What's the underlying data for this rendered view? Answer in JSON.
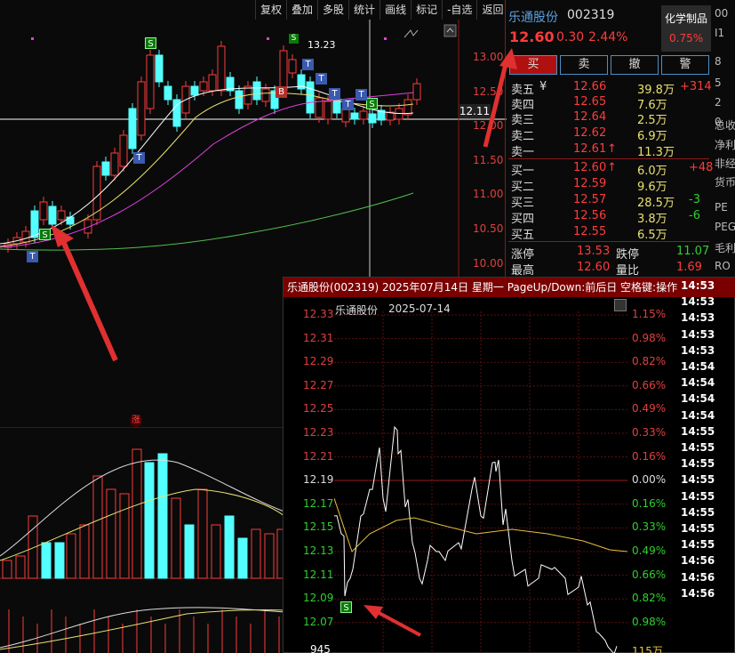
{
  "toolbar": {
    "items": [
      "复权",
      "叠加",
      "多股",
      "统计",
      "画线",
      "标记",
      "-自选",
      "返回"
    ]
  },
  "stock": {
    "name": "乐通股份",
    "code": "002319",
    "price": "12.60",
    "change": "0.30",
    "pct": "2.44%",
    "sector": "化学制品",
    "sector_pct": "0.75%"
  },
  "trade_buttons": {
    "buy": "买",
    "sell": "卖",
    "cancel": "撤",
    "alert": "警"
  },
  "kline": {
    "price_labels": [
      "13.00",
      "12.50",
      "12.00",
      "11.50",
      "11.00",
      "10.50",
      "10.00"
    ],
    "current_price_tag": "12.11",
    "high_label": "13.23",
    "markers": {
      "s": "S",
      "t": "T",
      "b": "B"
    },
    "limit_up_icon": "涨"
  },
  "order_book": {
    "asks": [
      {
        "label": "卖五",
        "price": "12.66",
        "vol": "39.8万",
        "extra": "+314",
        "yen": "¥"
      },
      {
        "label": "卖四",
        "price": "12.65",
        "vol": "7.6万",
        "extra": ""
      },
      {
        "label": "卖三",
        "price": "12.64",
        "vol": "2.5万",
        "extra": ""
      },
      {
        "label": "卖二",
        "price": "12.62",
        "vol": "6.9万",
        "extra": ""
      },
      {
        "label": "卖一",
        "price": "12.61",
        "vol": "11.3万",
        "extra": "",
        "arrow": "↑"
      }
    ],
    "bids": [
      {
        "label": "买一",
        "price": "12.60",
        "vol": "6.0万",
        "extra": "+48",
        "arrow": "↑"
      },
      {
        "label": "买二",
        "price": "12.59",
        "vol": "9.6万",
        "extra": ""
      },
      {
        "label": "买三",
        "price": "12.57",
        "vol": "28.5万",
        "extra": "-3"
      },
      {
        "label": "买四",
        "price": "12.56",
        "vol": "3.8万",
        "extra": "-6"
      },
      {
        "label": "买五",
        "price": "12.55",
        "vol": "6.5万",
        "extra": ""
      }
    ],
    "stats": [
      {
        "l1": "涨停",
        "v1": "13.53",
        "l2": "跌停",
        "v2": "11.07"
      },
      {
        "l1": "最高",
        "v1": "12.60",
        "l2": "量比",
        "v2": "1.69"
      }
    ]
  },
  "sidebar": {
    "items": [
      "00",
      "I1",
      "8",
      "5",
      "2",
      "0",
      "总收",
      "净利",
      "非经",
      "货币",
      "PE",
      "PEG",
      "毛利",
      "RO"
    ]
  },
  "popup": {
    "title": "乐通股份(002319) 2025年07月14日 星期一 PageUp/Down:前后日 空格键:操作",
    "subtitle_name": "乐通股份",
    "subtitle_date": "2025-07-14",
    "left_labels": [
      "12.33",
      "12.31",
      "12.29",
      "12.27",
      "12.25",
      "12.23",
      "12.21",
      "12.19",
      "12.17",
      "12.15",
      "12.13",
      "12.11",
      "12.09",
      "12.07"
    ],
    "right_labels": [
      "1.15%",
      "0.98%",
      "0.82%",
      "0.66%",
      "0.49%",
      "0.33%",
      "0.16%",
      "0.00%",
      "0.16%",
      "0.33%",
      "0.49%",
      "0.66%",
      "0.82%",
      "0.98%"
    ],
    "vol_left": "945",
    "vol_right": "115万",
    "s_marker": "S"
  },
  "times": [
    "14:53",
    "14:53",
    "14:53",
    "14:53",
    "14:53",
    "14:54",
    "14:54",
    "14:54",
    "14:54",
    "14:55",
    "14:55",
    "14:55",
    "14:55",
    "14:55",
    "14:55",
    "14:55",
    "14:55",
    "14:56",
    "14:56",
    "14:56"
  ],
  "colors": {
    "up": "#ff3b3b",
    "down": "#54ffff",
    "ma5": "#ffffff",
    "ma10": "#e8e070",
    "ma20": "#e040e0",
    "ma60": "#50c050",
    "accent": "#ff6600"
  }
}
